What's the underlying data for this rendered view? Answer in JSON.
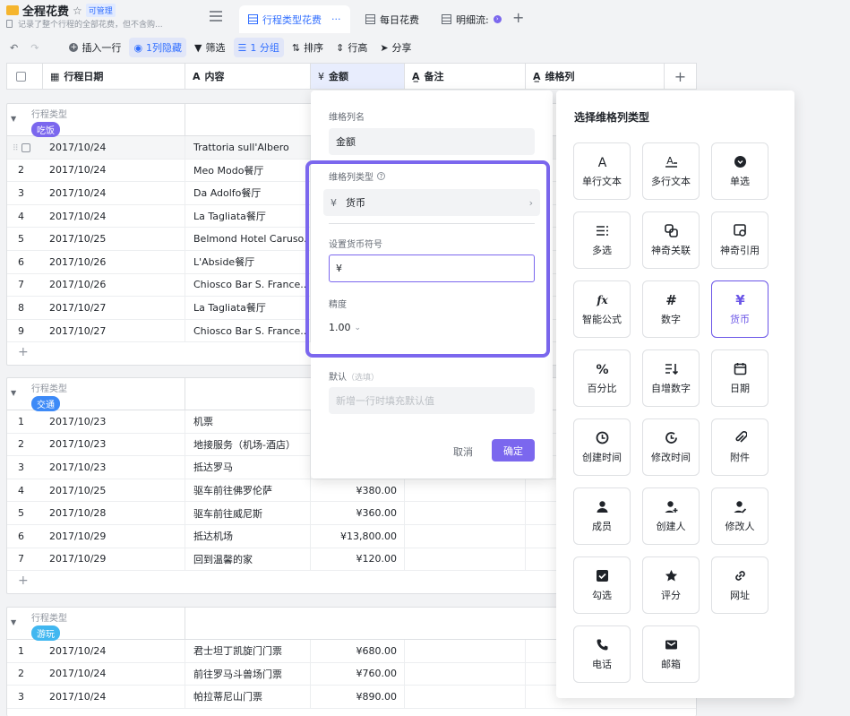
{
  "app": {
    "title": "全程花费",
    "permission": "可管理",
    "description": "记录了整个行程的全部花费，但不含购..."
  },
  "tabs": [
    {
      "label": "行程类型花费"
    },
    {
      "label": "每日花费"
    },
    {
      "label": "明细流:"
    }
  ],
  "toolbar": {
    "insert": "插入一行",
    "hidden": "1列隐藏",
    "filter": "筛选",
    "group": "1 分组",
    "sort": "排序",
    "rowheight": "行高",
    "share": "分享"
  },
  "columns": {
    "date": "行程日期",
    "content": "内容",
    "amount": "金额",
    "note": "备注",
    "dim": "维格列"
  },
  "groups": [
    {
      "label": "行程类型",
      "tag": "吃饭",
      "tag_color": "#7b67ee",
      "rows": [
        {
          "n": "1",
          "date": "2017/10/24",
          "content": "Trattoria sull'Albero",
          "amount": ""
        },
        {
          "n": "2",
          "date": "2017/10/24",
          "content": "Meo Modo餐厅",
          "amount": ""
        },
        {
          "n": "3",
          "date": "2017/10/24",
          "content": "Da Adolfo餐厅",
          "amount": ""
        },
        {
          "n": "4",
          "date": "2017/10/24",
          "content": "La Tagliata餐厅",
          "amount": ""
        },
        {
          "n": "5",
          "date": "2017/10/25",
          "content": "Belmond Hotel Caruso...",
          "amount": ""
        },
        {
          "n": "6",
          "date": "2017/10/26",
          "content": "L'Abside餐厅",
          "amount": ""
        },
        {
          "n": "7",
          "date": "2017/10/26",
          "content": "Chiosco Bar S. France...",
          "amount": ""
        },
        {
          "n": "8",
          "date": "2017/10/27",
          "content": "La Tagliata餐厅",
          "amount": ""
        },
        {
          "n": "9",
          "date": "2017/10/27",
          "content": "Chiosco Bar S. France...",
          "amount": ""
        }
      ]
    },
    {
      "label": "行程类型",
      "tag": "交通",
      "tag_color": "#3d8af7",
      "rows": [
        {
          "n": "1",
          "date": "2017/10/23",
          "content": "机票",
          "amount": ""
        },
        {
          "n": "2",
          "date": "2017/10/23",
          "content": "地接服务（机场-酒店）",
          "amount": ""
        },
        {
          "n": "3",
          "date": "2017/10/23",
          "content": "抵达罗马",
          "amount": ""
        },
        {
          "n": "4",
          "date": "2017/10/25",
          "content": "驱车前往佛罗伦萨",
          "amount": "¥380.00"
        },
        {
          "n": "5",
          "date": "2017/10/28",
          "content": "驱车前往威尼斯",
          "amount": "¥360.00"
        },
        {
          "n": "6",
          "date": "2017/10/29",
          "content": "抵达机场",
          "amount": "¥13,800.00"
        },
        {
          "n": "7",
          "date": "2017/10/29",
          "content": "回到温馨的家",
          "amount": "¥120.00"
        }
      ]
    },
    {
      "label": "行程类型",
      "tag": "游玩",
      "tag_color": "#41b7f0",
      "rows": [
        {
          "n": "1",
          "date": "2017/10/24",
          "content": "君士坦丁凯旋门门票",
          "amount": "¥680.00"
        },
        {
          "n": "2",
          "date": "2017/10/24",
          "content": "前往罗马斗兽场门票",
          "amount": "¥760.00"
        },
        {
          "n": "3",
          "date": "2017/10/24",
          "content": "帕拉蒂尼山门票",
          "amount": "¥890.00"
        }
      ]
    }
  ],
  "popup": {
    "name_label": "维格列名",
    "name_value": "金额",
    "type_label": "维格列类型",
    "type_value": "货币",
    "symbol_label": "设置货币符号",
    "symbol_value": "¥",
    "precision_label": "精度",
    "precision_value": "1.00",
    "default_label": "默认",
    "default_hint": "（选填）",
    "default_placeholder": "新增一行时填充默认值",
    "cancel": "取消",
    "confirm": "确定",
    "accent": "#7b67ee"
  },
  "panel": {
    "title": "选择维格列类型",
    "types": [
      {
        "label": "单行文本",
        "icon": "single-text-icon"
      },
      {
        "label": "多行文本",
        "icon": "multi-text-icon"
      },
      {
        "label": "单选",
        "icon": "single-select-icon"
      },
      {
        "label": "多选",
        "icon": "multi-select-icon"
      },
      {
        "label": "神奇关联",
        "icon": "link-icon"
      },
      {
        "label": "神奇引用",
        "icon": "lookup-icon"
      },
      {
        "label": "智能公式",
        "icon": "formula-icon"
      },
      {
        "label": "数字",
        "icon": "number-icon"
      },
      {
        "label": "货币",
        "icon": "currency-icon"
      },
      {
        "label": "百分比",
        "icon": "percent-icon"
      },
      {
        "label": "自增数字",
        "icon": "autonumber-icon"
      },
      {
        "label": "日期",
        "icon": "date-icon"
      },
      {
        "label": "创建时间",
        "icon": "created-time-icon"
      },
      {
        "label": "修改时间",
        "icon": "modified-time-icon"
      },
      {
        "label": "附件",
        "icon": "attachment-icon"
      },
      {
        "label": "成员",
        "icon": "member-icon"
      },
      {
        "label": "创建人",
        "icon": "creator-icon"
      },
      {
        "label": "修改人",
        "icon": "editor-icon"
      },
      {
        "label": "勾选",
        "icon": "checkbox-icon"
      },
      {
        "label": "评分",
        "icon": "rating-icon"
      },
      {
        "label": "网址",
        "icon": "url-icon"
      },
      {
        "label": "电话",
        "icon": "phone-icon"
      },
      {
        "label": "邮箱",
        "icon": "email-icon"
      }
    ],
    "selected": "货币"
  }
}
